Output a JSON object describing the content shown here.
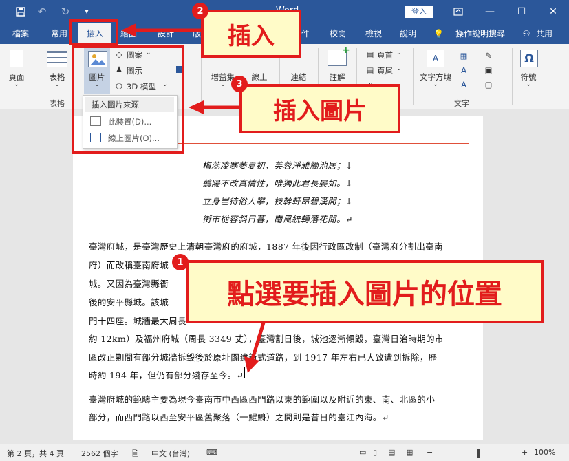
{
  "titlebar": {
    "title": "- Word",
    "login_label": "登入",
    "save_icon": "save-icon",
    "undo_icon": "undo-icon",
    "redo_icon": "redo-icon",
    "customize_icon": "chevron-down-icon"
  },
  "tabs": [
    "檔案",
    "常用",
    "插入",
    "繪圖",
    "設計",
    "版",
    "件",
    "校閱",
    "檢視",
    "說明",
    "操作說明搜尋",
    "共用"
  ],
  "ribbon": {
    "pages": "頁面",
    "table": "表格",
    "table_group": "表格",
    "pictures": "圖片",
    "shapes": "圖案",
    "icons": "圖示",
    "model3d": "3D 模型",
    "addins": "增益集",
    "online_video": "線上",
    "links": "連結",
    "comment": "註解",
    "header": "頁首",
    "footer": "頁尾",
    "textbox": "文字方塊",
    "text_group": "文字",
    "symbols": "符號",
    "omega": "Ω"
  },
  "dropdown": {
    "title": "插入圖片來源",
    "this_device": "此裝置(D)...",
    "online_pictures": "線上圖片(O)..."
  },
  "callouts": {
    "insert": "插入",
    "insert_picture": "插入圖片",
    "select_position": "點選要插入圖片的位置"
  },
  "badges": [
    "1",
    "2",
    "3"
  ],
  "document": {
    "poem": [
      "梅蕊凌寒萎夏初，芙蓉淨雅觸池居；↓",
      "鶺陽不改真情性，唯獨此君長晏如。↓",
      "立身岂待俗人攀，枝幹軒昂碧漢間；↓",
      "街市從容斜日暮，南風統轉落花閒。↵"
    ],
    "para1": [
      "臺灣府城，是臺灣歷史上清朝臺灣府的府城，1887 年後因行政區改制（臺灣府分割出臺南",
      "府）而改稱臺南府城",
      "城。又因為臺灣縣衙",
      "後的安平縣城。該城",
      "門十四座。城牆最大周長",
      "約 12km）及福州府城（周長 3349 丈），臺灣割日後，城池逐漸傾毀，臺灣日治時期的市",
      "區改正期間有部分城牆拆毀後於原址闢建新式道路，到 1917 年左右已大致遭到拆除，歷",
      "時約 194 年，但仍有部分殘存至今。↵"
    ],
    "para2": [
      "臺灣府城的範疇主要為現今臺南市中西區西門路以東的範圍以及附近的東、南、北區的小",
      "部分，而西門路以西至安平區舊聚落（一鯤鯓）之間則是昔日的臺江內海。↵"
    ]
  },
  "status": {
    "page": "第 2 頁，共 4 頁",
    "words": "2562 個字",
    "language": "中文 (台灣)",
    "zoom": "100%"
  },
  "colors": {
    "accent": "#2b579a",
    "callout_red": "#e21c1c",
    "callout_fill": "#fffbc8"
  }
}
